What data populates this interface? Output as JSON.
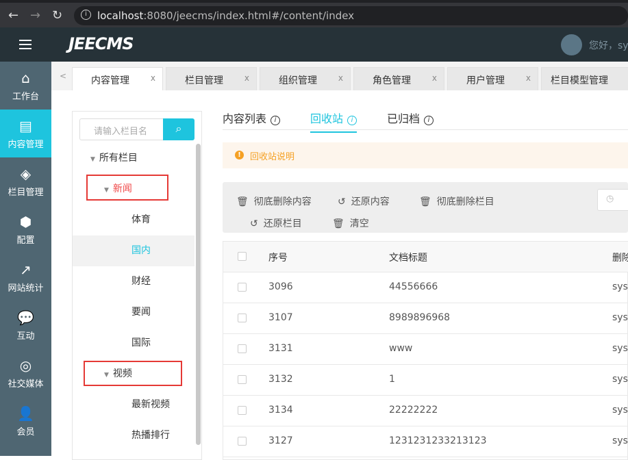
{
  "browser": {
    "url_host": "localhost",
    "url_rest": ":8080/jeecms/index.html#/content/index"
  },
  "header": {
    "logo": "JEECMS",
    "greeting": "您好，sy"
  },
  "sidebar": [
    {
      "label": "工作台",
      "icon": "⌂"
    },
    {
      "label": "内容管理",
      "icon": "▤"
    },
    {
      "label": "栏目管理",
      "icon": "◈"
    },
    {
      "label": "配置",
      "icon": "⬢"
    },
    {
      "label": "网站统计",
      "icon": "↗"
    },
    {
      "label": "互动",
      "icon": "💬"
    },
    {
      "label": "社交媒体",
      "icon": "◎"
    },
    {
      "label": "会员",
      "icon": "👤"
    }
  ],
  "tabs": [
    {
      "label": "内容管理",
      "close": "x"
    },
    {
      "label": "栏目管理",
      "close": "x"
    },
    {
      "label": "组织管理",
      "close": "x"
    },
    {
      "label": "角色管理",
      "close": "x"
    },
    {
      "label": "用户管理",
      "close": "x"
    },
    {
      "label": "栏目模型管理",
      "close": ""
    }
  ],
  "tree": {
    "placeholder": "请输入栏目名",
    "nodes": [
      {
        "label": "所有栏目",
        "level": 0,
        "caret": "▼"
      },
      {
        "label": "新闻",
        "level": 1,
        "caret": "▼"
      },
      {
        "label": "体育",
        "level": 2
      },
      {
        "label": "国内",
        "level": 2
      },
      {
        "label": "财经",
        "level": 2
      },
      {
        "label": "要闻",
        "level": 2
      },
      {
        "label": "国际",
        "level": 2
      },
      {
        "label": "视频",
        "level": 1,
        "caret": "▼"
      },
      {
        "label": "最新视频",
        "level": 2
      },
      {
        "label": "热播排行",
        "level": 2
      }
    ]
  },
  "content_tabs": [
    {
      "label": "内容列表"
    },
    {
      "label": "回收站"
    },
    {
      "label": "已归档"
    }
  ],
  "notice": "回收站说明",
  "toolbar": {
    "delete_content": "彻底删除内容",
    "restore_content": "还原内容",
    "delete_column": "彻底删除栏目",
    "restore_column": "还原栏目",
    "clear": "清空"
  },
  "table": {
    "headers": [
      "序号",
      "文档标题",
      "删除"
    ],
    "rows": [
      {
        "id": "3096",
        "title": "44556666",
        "deleter": "syst"
      },
      {
        "id": "3107",
        "title": "8989896968",
        "deleter": "syst"
      },
      {
        "id": "3131",
        "title": "www",
        "deleter": "syst"
      },
      {
        "id": "3132",
        "title": "1",
        "deleter": "syst"
      },
      {
        "id": "3134",
        "title": "22222222",
        "deleter": "syst"
      },
      {
        "id": "3127",
        "title": "1231231233213123",
        "deleter": "syst"
      }
    ]
  }
}
